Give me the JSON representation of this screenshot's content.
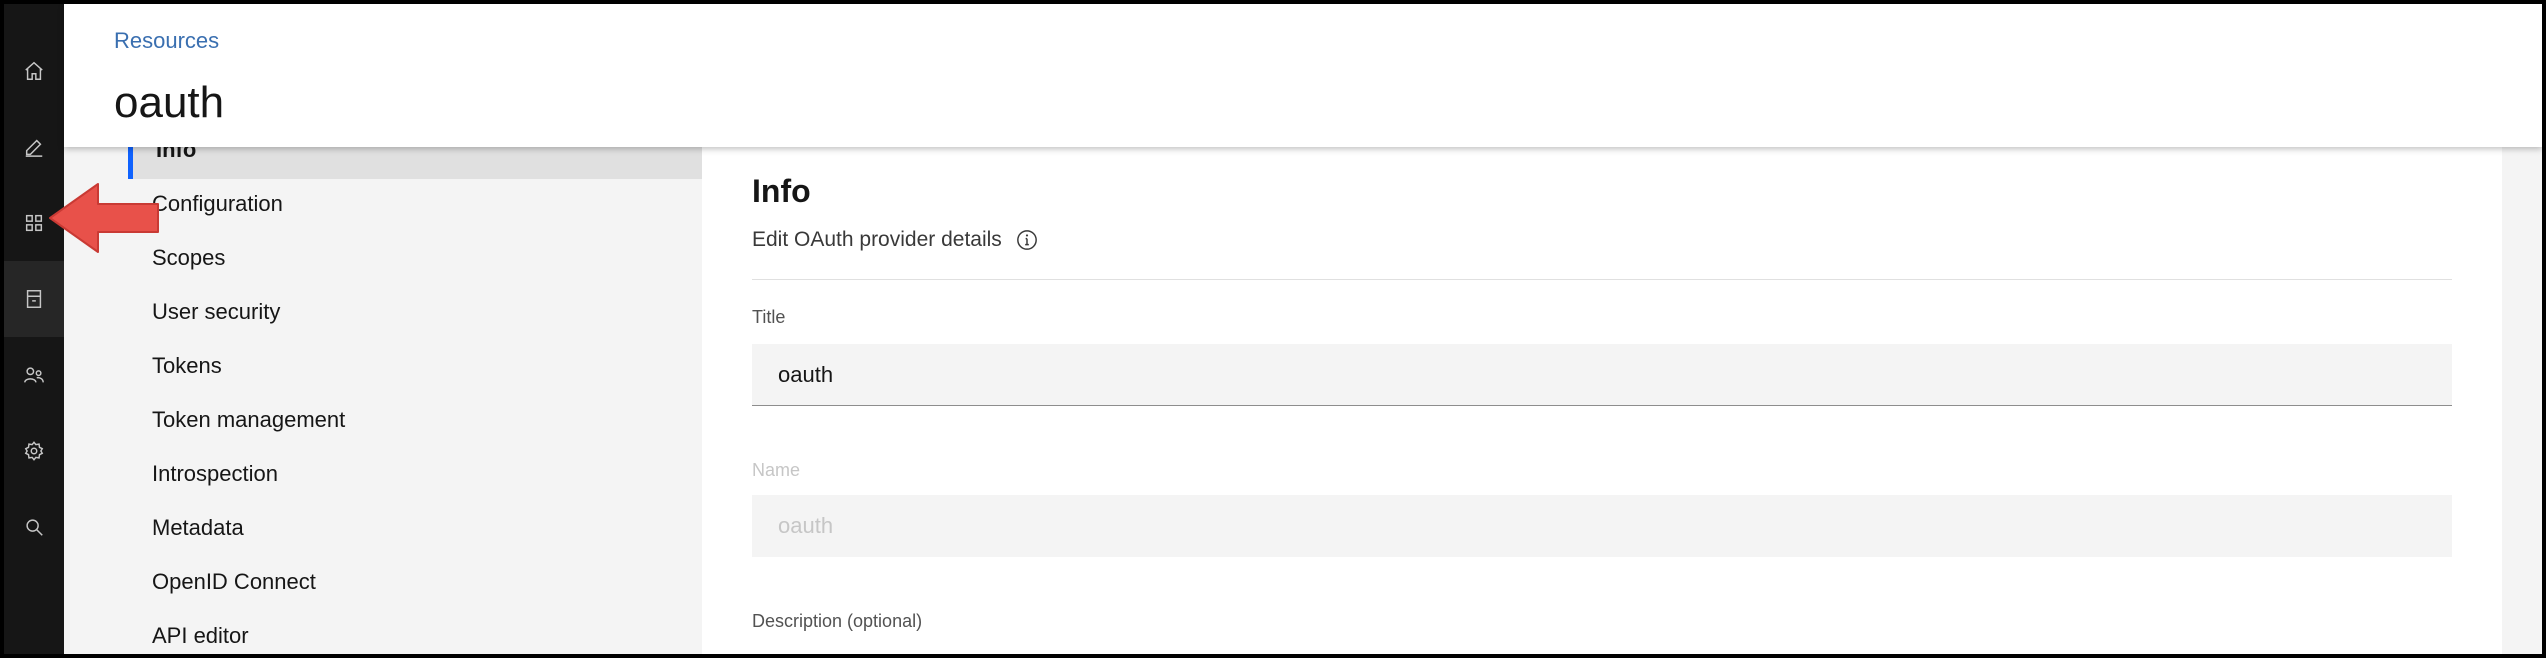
{
  "rail": {
    "icons": [
      "home-icon",
      "edit-icon",
      "apps-grid-icon",
      "data-store-icon",
      "users-icon",
      "settings-icon",
      "search-icon"
    ]
  },
  "header": {
    "breadcrumb": "Resources",
    "title": "oauth"
  },
  "subnav": {
    "active": "Info",
    "items": [
      "Configuration",
      "Scopes",
      "User security",
      "Tokens",
      "Token management",
      "Introspection",
      "Metadata",
      "OpenID Connect",
      "API editor"
    ]
  },
  "main": {
    "section_title": "Info",
    "section_subtitle": "Edit OAuth provider details",
    "fields": {
      "title_label": "Title",
      "title_value": "oauth",
      "name_label": "Name",
      "name_value": "oauth",
      "description_label": "Description (optional)"
    }
  },
  "colors": {
    "rail_bg": "#161616",
    "accent": "#0f62fe",
    "annotation_arrow": "#e8514a"
  }
}
